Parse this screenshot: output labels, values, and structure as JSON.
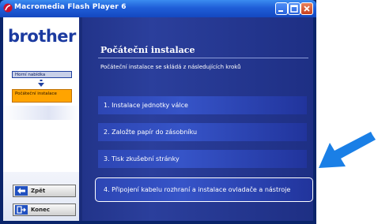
{
  "window": {
    "title": "Macromedia Flash Player 6",
    "controls": {
      "minimize": "minimize",
      "maximize": "maximize",
      "close": "close"
    }
  },
  "sidebar": {
    "logo": "brother",
    "nav": {
      "home": "Horní nabídka",
      "current": "Počáteční instalace"
    },
    "buttons": {
      "back": "Zpět",
      "end": "Konec"
    }
  },
  "main": {
    "heading": "Počáteční instalace",
    "intro": "Počáteční instalace se skládá z následujících kroků",
    "steps": [
      {
        "label": "1. Instalace jednotky válce"
      },
      {
        "label": "2. Založte papír do zásobníku"
      },
      {
        "label": "3. Tisk zkušební stránky"
      },
      {
        "label": "4. Připojení kabelu rozhraní a instalace ovladače a nástroje"
      }
    ]
  },
  "colors": {
    "titlebar": "#2262dc",
    "content_bg": "#22348a",
    "step_bg": "#3654c8",
    "current_nav": "#ffa400",
    "pointer_arrow": "#1a7fe6",
    "logo": "#1b3aa0"
  },
  "icons": {
    "title_icon": "flash-player-icon",
    "back_icon": "back-arrow-icon",
    "end_icon": "exit-icon",
    "nav_arrow": "down-arrow-icon",
    "pointer": "pointer-arrow-icon"
  }
}
